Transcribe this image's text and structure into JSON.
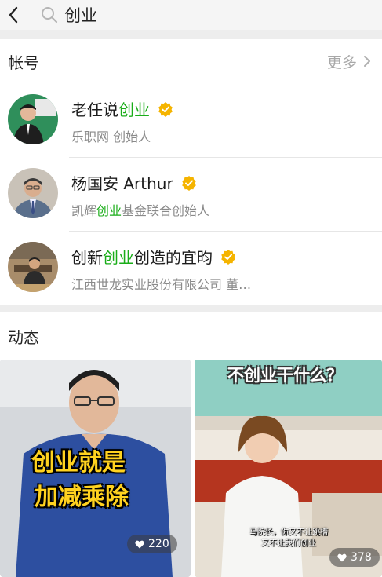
{
  "header": {
    "query": "创业"
  },
  "accounts": {
    "title": "帐号",
    "more_label": "更多",
    "items": [
      {
        "name_prefix": "老任说",
        "name_highlight": "创业",
        "name_suffix": "",
        "sub_prefix": "乐职网 创始人",
        "sub_highlight": "",
        "sub_suffix": ""
      },
      {
        "name_prefix": "杨国安 Arthur",
        "name_highlight": "",
        "name_suffix": "",
        "sub_prefix": "凯辉",
        "sub_highlight": "创业",
        "sub_suffix": "基金联合创始人"
      },
      {
        "name_prefix": "创新",
        "name_highlight": "创业",
        "name_suffix": "创造的宜昀",
        "sub_prefix": "江西世龙实业股份有限公司 董…",
        "sub_highlight": "",
        "sub_suffix": ""
      }
    ]
  },
  "feed": {
    "title": "动态",
    "cards": [
      {
        "caption_line1": "创业就是",
        "caption_line2": "加减乘除",
        "likes": "220"
      },
      {
        "banner": "不创业干什么？",
        "subtitle_line1": "马院长，你又不让跳槽",
        "subtitle_line2": "又不让我们创业",
        "likes": "378"
      }
    ]
  },
  "colors": {
    "highlight": "#1aad19",
    "verified": "#f5b400",
    "caption": "#ffd21f",
    "card_right_bg": "#8fcfc3"
  }
}
